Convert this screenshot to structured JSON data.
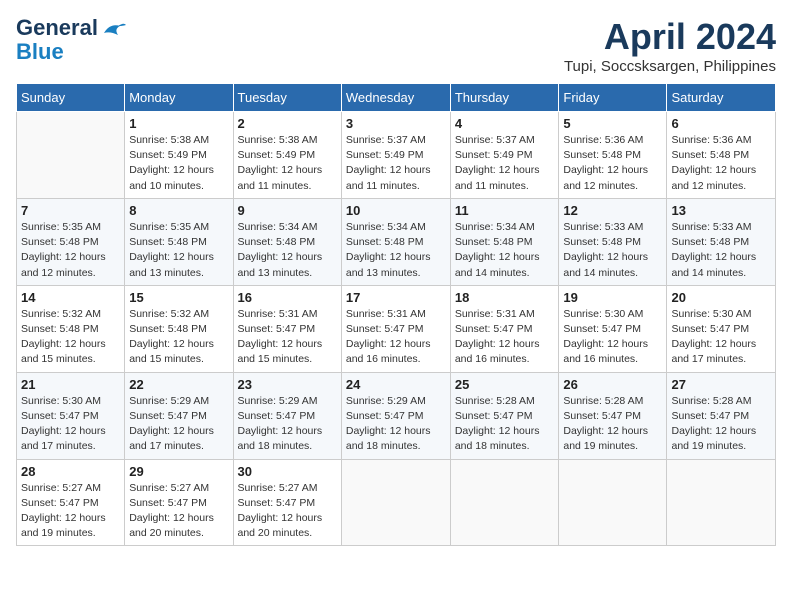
{
  "header": {
    "logo_line1": "General",
    "logo_line2": "Blue",
    "month_title": "April 2024",
    "location": "Tupi, Soccsksargen, Philippines"
  },
  "weekdays": [
    "Sunday",
    "Monday",
    "Tuesday",
    "Wednesday",
    "Thursday",
    "Friday",
    "Saturday"
  ],
  "weeks": [
    [
      {
        "day": "",
        "info": ""
      },
      {
        "day": "1",
        "info": "Sunrise: 5:38 AM\nSunset: 5:49 PM\nDaylight: 12 hours\nand 10 minutes."
      },
      {
        "day": "2",
        "info": "Sunrise: 5:38 AM\nSunset: 5:49 PM\nDaylight: 12 hours\nand 11 minutes."
      },
      {
        "day": "3",
        "info": "Sunrise: 5:37 AM\nSunset: 5:49 PM\nDaylight: 12 hours\nand 11 minutes."
      },
      {
        "day": "4",
        "info": "Sunrise: 5:37 AM\nSunset: 5:49 PM\nDaylight: 12 hours\nand 11 minutes."
      },
      {
        "day": "5",
        "info": "Sunrise: 5:36 AM\nSunset: 5:48 PM\nDaylight: 12 hours\nand 12 minutes."
      },
      {
        "day": "6",
        "info": "Sunrise: 5:36 AM\nSunset: 5:48 PM\nDaylight: 12 hours\nand 12 minutes."
      }
    ],
    [
      {
        "day": "7",
        "info": "Sunrise: 5:35 AM\nSunset: 5:48 PM\nDaylight: 12 hours\nand 12 minutes."
      },
      {
        "day": "8",
        "info": "Sunrise: 5:35 AM\nSunset: 5:48 PM\nDaylight: 12 hours\nand 13 minutes."
      },
      {
        "day": "9",
        "info": "Sunrise: 5:34 AM\nSunset: 5:48 PM\nDaylight: 12 hours\nand 13 minutes."
      },
      {
        "day": "10",
        "info": "Sunrise: 5:34 AM\nSunset: 5:48 PM\nDaylight: 12 hours\nand 13 minutes."
      },
      {
        "day": "11",
        "info": "Sunrise: 5:34 AM\nSunset: 5:48 PM\nDaylight: 12 hours\nand 14 minutes."
      },
      {
        "day": "12",
        "info": "Sunrise: 5:33 AM\nSunset: 5:48 PM\nDaylight: 12 hours\nand 14 minutes."
      },
      {
        "day": "13",
        "info": "Sunrise: 5:33 AM\nSunset: 5:48 PM\nDaylight: 12 hours\nand 14 minutes."
      }
    ],
    [
      {
        "day": "14",
        "info": "Sunrise: 5:32 AM\nSunset: 5:48 PM\nDaylight: 12 hours\nand 15 minutes."
      },
      {
        "day": "15",
        "info": "Sunrise: 5:32 AM\nSunset: 5:48 PM\nDaylight: 12 hours\nand 15 minutes."
      },
      {
        "day": "16",
        "info": "Sunrise: 5:31 AM\nSunset: 5:47 PM\nDaylight: 12 hours\nand 15 minutes."
      },
      {
        "day": "17",
        "info": "Sunrise: 5:31 AM\nSunset: 5:47 PM\nDaylight: 12 hours\nand 16 minutes."
      },
      {
        "day": "18",
        "info": "Sunrise: 5:31 AM\nSunset: 5:47 PM\nDaylight: 12 hours\nand 16 minutes."
      },
      {
        "day": "19",
        "info": "Sunrise: 5:30 AM\nSunset: 5:47 PM\nDaylight: 12 hours\nand 16 minutes."
      },
      {
        "day": "20",
        "info": "Sunrise: 5:30 AM\nSunset: 5:47 PM\nDaylight: 12 hours\nand 17 minutes."
      }
    ],
    [
      {
        "day": "21",
        "info": "Sunrise: 5:30 AM\nSunset: 5:47 PM\nDaylight: 12 hours\nand 17 minutes."
      },
      {
        "day": "22",
        "info": "Sunrise: 5:29 AM\nSunset: 5:47 PM\nDaylight: 12 hours\nand 17 minutes."
      },
      {
        "day": "23",
        "info": "Sunrise: 5:29 AM\nSunset: 5:47 PM\nDaylight: 12 hours\nand 18 minutes."
      },
      {
        "day": "24",
        "info": "Sunrise: 5:29 AM\nSunset: 5:47 PM\nDaylight: 12 hours\nand 18 minutes."
      },
      {
        "day": "25",
        "info": "Sunrise: 5:28 AM\nSunset: 5:47 PM\nDaylight: 12 hours\nand 18 minutes."
      },
      {
        "day": "26",
        "info": "Sunrise: 5:28 AM\nSunset: 5:47 PM\nDaylight: 12 hours\nand 19 minutes."
      },
      {
        "day": "27",
        "info": "Sunrise: 5:28 AM\nSunset: 5:47 PM\nDaylight: 12 hours\nand 19 minutes."
      }
    ],
    [
      {
        "day": "28",
        "info": "Sunrise: 5:27 AM\nSunset: 5:47 PM\nDaylight: 12 hours\nand 19 minutes."
      },
      {
        "day": "29",
        "info": "Sunrise: 5:27 AM\nSunset: 5:47 PM\nDaylight: 12 hours\nand 20 minutes."
      },
      {
        "day": "30",
        "info": "Sunrise: 5:27 AM\nSunset: 5:47 PM\nDaylight: 12 hours\nand 20 minutes."
      },
      {
        "day": "",
        "info": ""
      },
      {
        "day": "",
        "info": ""
      },
      {
        "day": "",
        "info": ""
      },
      {
        "day": "",
        "info": ""
      }
    ]
  ]
}
